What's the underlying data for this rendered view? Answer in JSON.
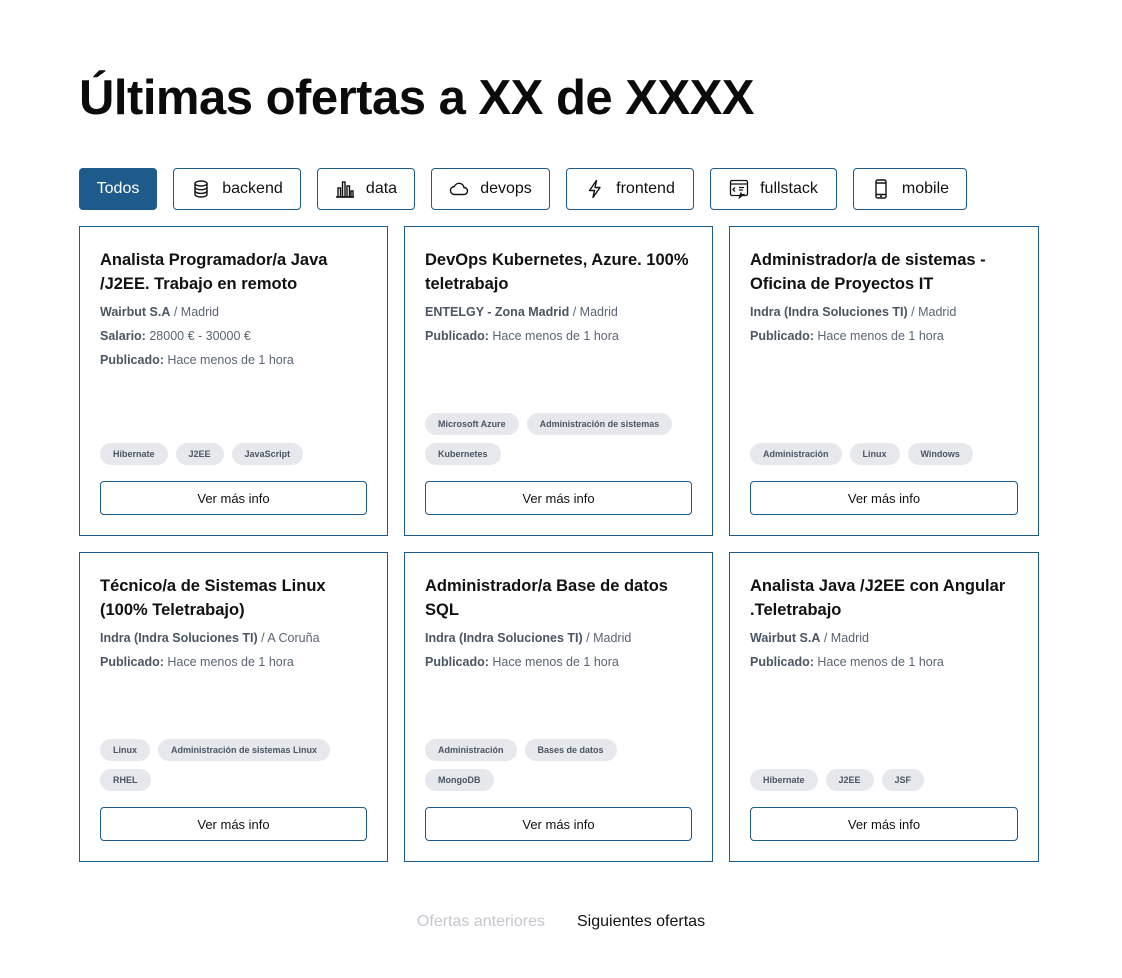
{
  "page": {
    "title": "Últimas ofertas a XX de XXXX"
  },
  "filters": [
    {
      "label": "Todos",
      "icon": "",
      "active": true
    },
    {
      "label": "backend",
      "icon": "database-icon",
      "active": false
    },
    {
      "label": "data",
      "icon": "bar-chart-icon",
      "active": false
    },
    {
      "label": "devops",
      "icon": "cloud-icon",
      "active": false
    },
    {
      "label": "frontend",
      "icon": "lightning-icon",
      "active": false
    },
    {
      "label": "fullstack",
      "icon": "code-window-icon",
      "active": false
    },
    {
      "label": "mobile",
      "icon": "phone-icon",
      "active": false
    }
  ],
  "labels": {
    "salary": "Salario:",
    "published": "Publicado:",
    "more_info": "Ver más info"
  },
  "jobs": [
    {
      "title": "Analista Programador/a Java /J2EE. Trabajo en remoto",
      "company": "Wairbut S.A",
      "location": "/ Madrid",
      "salary": "28000 € - 30000 €",
      "published": "Hace menos de 1 hora",
      "tags": [
        "Hibernate",
        "J2EE",
        "JavaScript"
      ]
    },
    {
      "title": "DevOps Kubernetes, Azure. 100% teletrabajo",
      "company": "ENTELGY - Zona Madrid",
      "location": "/ Madrid",
      "salary": "",
      "published": "Hace menos de 1 hora",
      "tags": [
        "Microsoft Azure",
        "Administración de sistemas",
        "Kubernetes"
      ]
    },
    {
      "title": "Administrador/a de sistemas - Oficina de Proyectos IT",
      "company": "Indra (Indra Soluciones TI)",
      "location": "/ Madrid",
      "salary": "",
      "published": "Hace menos de 1 hora",
      "tags": [
        "Administración",
        "Linux",
        "Windows"
      ]
    },
    {
      "title": "Técnico/a de Sistemas Linux (100% Teletrabajo)",
      "company": "Indra (Indra Soluciones TI)",
      "location": "/ A Coruña",
      "salary": "",
      "published": "Hace menos de 1 hora",
      "tags": [
        "Linux",
        "Administración de sistemas Linux",
        "RHEL"
      ]
    },
    {
      "title": "Administrador/a Base de datos SQL",
      "company": "Indra (Indra Soluciones TI)",
      "location": "/ Madrid",
      "salary": "",
      "published": "Hace menos de 1 hora",
      "tags": [
        "Administración",
        "Bases de datos",
        "MongoDB"
      ]
    },
    {
      "title": "Analista Java /J2EE con Angular .Teletrabajo",
      "company": "Wairbut S.A",
      "location": "/ Madrid",
      "salary": "",
      "published": "Hace menos de 1 hora",
      "tags": [
        "Hibernate",
        "J2EE",
        "JSF"
      ]
    }
  ],
  "pagination": {
    "previous": "Ofertas anteriores",
    "previous_enabled": false,
    "next": "Siguientes ofertas",
    "next_enabled": true
  },
  "colors": {
    "accent": "#1d5b8a",
    "tag_bg": "#e6e8ec",
    "disabled_text": "#c4c8ce"
  }
}
